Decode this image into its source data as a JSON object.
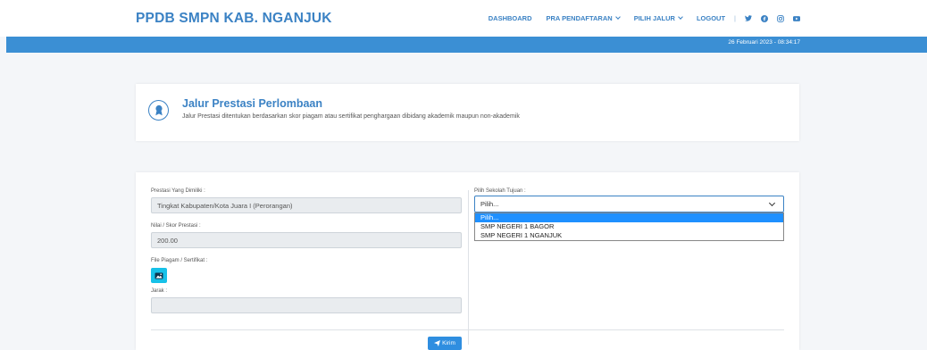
{
  "header": {
    "brand": "PPDB SMPN KAB. NGANJUK",
    "nav": {
      "dashboard": "DASHBOARD",
      "pra_pendaftaran": "PRA PENDAFTARAN",
      "pilih_jalur": "PILIH JALUR",
      "logout": "LOGOUT",
      "separator": "|"
    },
    "social_icons": [
      "twitter-icon",
      "facebook-icon",
      "instagram-icon",
      "youtube-icon"
    ]
  },
  "status_bar": {
    "datetime": "26 Februari 2023 - 08:34:17"
  },
  "info_card": {
    "icon": "medal-icon",
    "title": "Jalur Prestasi Perlombaan",
    "description": "Jalur Prestasi ditentukan berdasarkan skor piagam atau sertifikat penghargaan dibidang akademik maupun non-akademik"
  },
  "form": {
    "prestasi_label": "Prestasi Yang Dimiliki :",
    "prestasi_value": "Tingkat Kabupaten/Kota Juara I (Perorangan)",
    "nilai_label": "Nilai / Skor Prestasi :",
    "nilai_value": "200.00",
    "file_label": "File Piagam / Sertifikat :",
    "jarak_label": "Jarak :",
    "jarak_value": "",
    "sekolah_label": "Pilih Sekolah Tujuan :",
    "sekolah_selected": "Pilih...",
    "sekolah_options": [
      "Pilih...",
      "SMP NEGERI 1 BAGOR",
      "SMP NEGERI 1 NGANJUK"
    ],
    "submit_label": "Kirim"
  },
  "colors": {
    "accent": "#3b82c4",
    "status_bar": "#3b8fd4",
    "upload_button": "#17c1e8",
    "option_highlight": "#1e90ff"
  }
}
